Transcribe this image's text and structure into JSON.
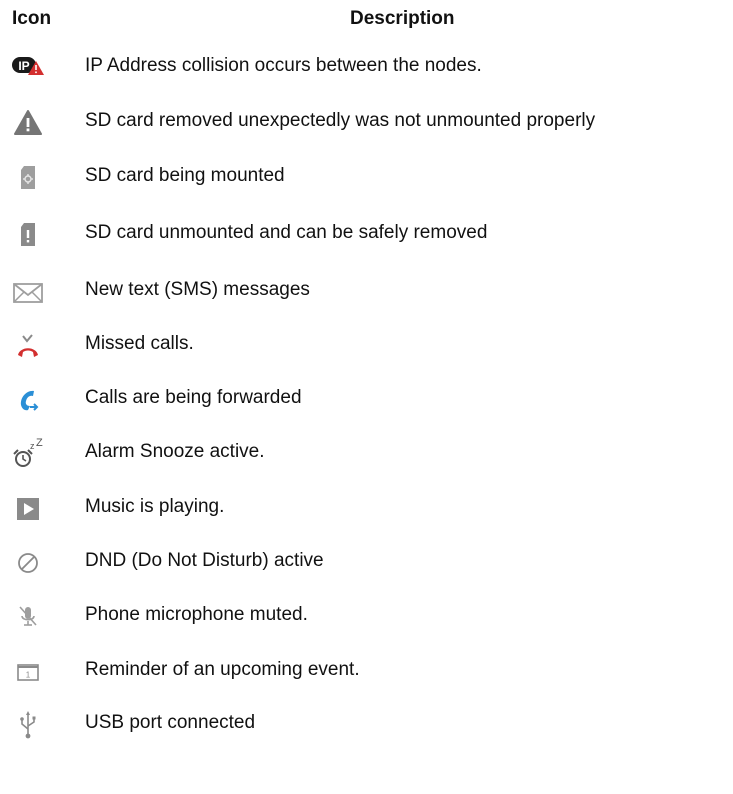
{
  "header": {
    "icon_label": "Icon",
    "description_label": "Description"
  },
  "rows": [
    {
      "icon": "ip-collision-icon",
      "description": "IP Address collision occurs between the nodes."
    },
    {
      "icon": "warning-icon",
      "description": "SD card removed unexpectedly was not unmounted properly"
    },
    {
      "icon": "sd-card-mounting-icon",
      "description": "SD card being mounted"
    },
    {
      "icon": "sd-card-unmounted-icon",
      "description": "SD card unmounted and can be safely removed"
    },
    {
      "icon": "envelope-icon",
      "description": "New text (SMS) messages"
    },
    {
      "icon": "missed-call-icon",
      "description": "Missed calls."
    },
    {
      "icon": "call-forward-icon",
      "description": "Calls are being forwarded"
    },
    {
      "icon": "alarm-snooze-icon",
      "description": "Alarm Snooze active."
    },
    {
      "icon": "play-icon",
      "description": "Music is playing."
    },
    {
      "icon": "do-not-disturb-icon",
      "description": "DND (Do Not Disturb) active"
    },
    {
      "icon": "mic-muted-icon",
      "description": "Phone microphone muted."
    },
    {
      "icon": "calendar-icon",
      "description": "Reminder of an upcoming event."
    },
    {
      "icon": "usb-icon",
      "description": "USB port connected"
    }
  ],
  "colors": {
    "ip_badge": "#1a1a1a",
    "alert_red": "#d32f2f",
    "gray_icon": "#8a8a8a",
    "call_blue": "#2b8fd6"
  }
}
